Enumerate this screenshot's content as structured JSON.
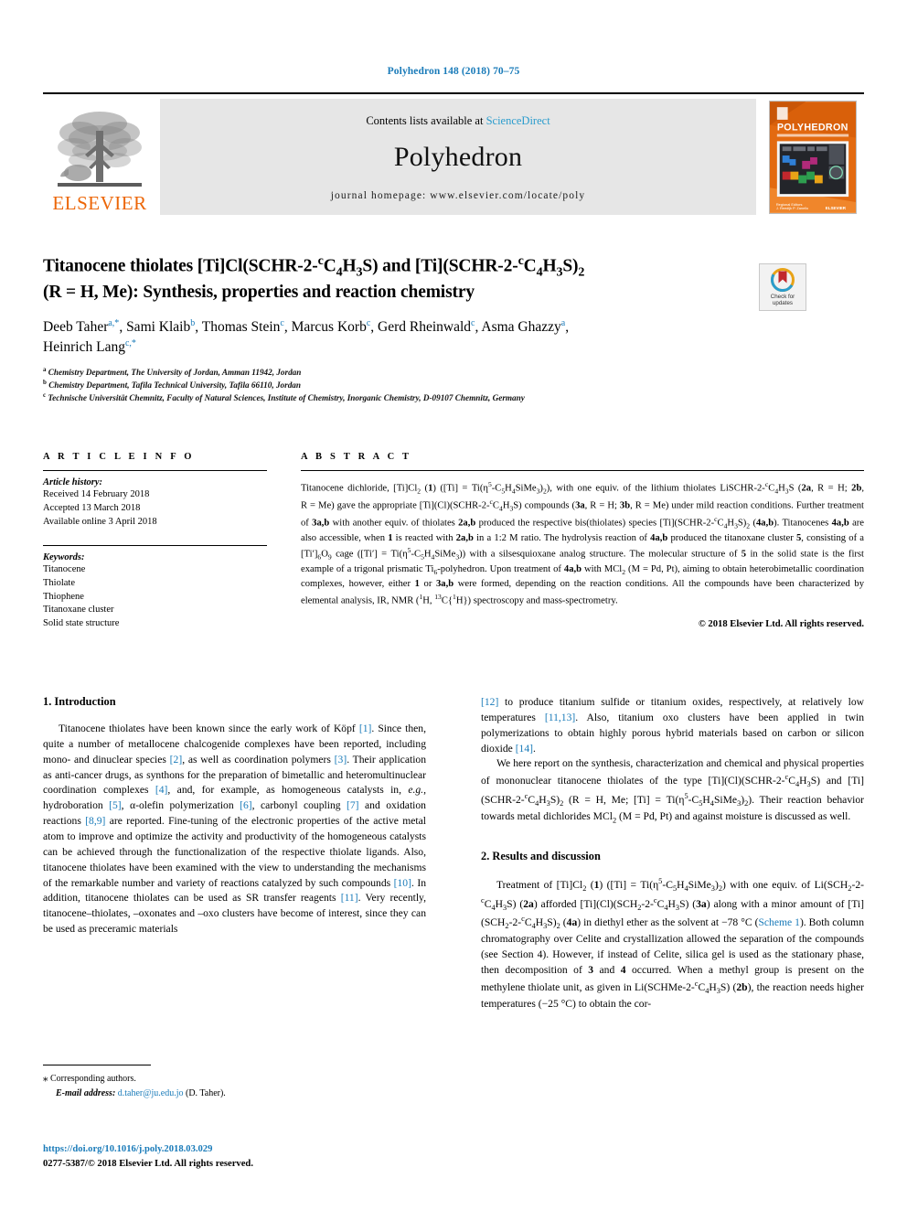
{
  "running_head": "Polyhedron 148 (2018) 70–75",
  "masthead": {
    "publisher_name": "ELSEVIER",
    "contents_prefix": "Contents lists available at ",
    "contents_link": "ScienceDirect",
    "journal_name": "Polyhedron",
    "homepage": "journal homepage: www.elsevier.com/locate/poly",
    "cover_title": "POLYHEDRON"
  },
  "article": {
    "title_line_1": "Titanocene thiolates [Ti]Cl(SCHR-2-ᶜC₄H₃S) and [Ti](SCHR-2-ᶜC₄H₃S)₂",
    "title_line_2": "(R = H, Me): Synthesis, properties and reaction chemistry",
    "crossmark_label_1": "Check for",
    "crossmark_label_2": "updates",
    "authors": "Deeb Taher a,*, Sami Klaib b, Thomas Stein c, Marcus Korb c, Gerd Rheinwald c, Asma Ghazzy a, Heinrich Lang c,*",
    "affiliations": [
      "a Chemistry Department, The University of Jordan, Amman 11942, Jordan",
      "b Chemistry Department, Tafila Technical University, Tafila 66110, Jordan",
      "c Technische Universität Chemnitz, Faculty of Natural Sciences, Institute of Chemistry, Inorganic Chemistry, D-09107 Chemnitz, Germany"
    ]
  },
  "article_info": {
    "heading": "A R T I C L E   I N F O",
    "history_label": "Article history:",
    "received": "Received 14 February 2018",
    "accepted": "Accepted 13 March 2018",
    "available": "Available online 3 April 2018",
    "keywords_label": "Keywords:",
    "keywords": [
      "Titanocene",
      "Thiolate",
      "Thiophene",
      "Titanoxane cluster",
      "Solid state structure"
    ]
  },
  "abstract": {
    "heading": "A B S T R A C T",
    "copyright": "© 2018 Elsevier Ltd. All rights reserved."
  },
  "sections": {
    "introduction_heading": "1. Introduction",
    "results_heading": "2. Results and discussion"
  },
  "footnote": {
    "corresponding": "Corresponding authors.",
    "email_label": "E-mail address:",
    "email": "d.taher@ju.edu.jo",
    "email_suffix": " (D. Taher)."
  },
  "footer": {
    "doi": "https://doi.org/10.1016/j.poly.2018.03.029",
    "issn": "0277-5387/© 2018 Elsevier Ltd. All rights reserved."
  }
}
